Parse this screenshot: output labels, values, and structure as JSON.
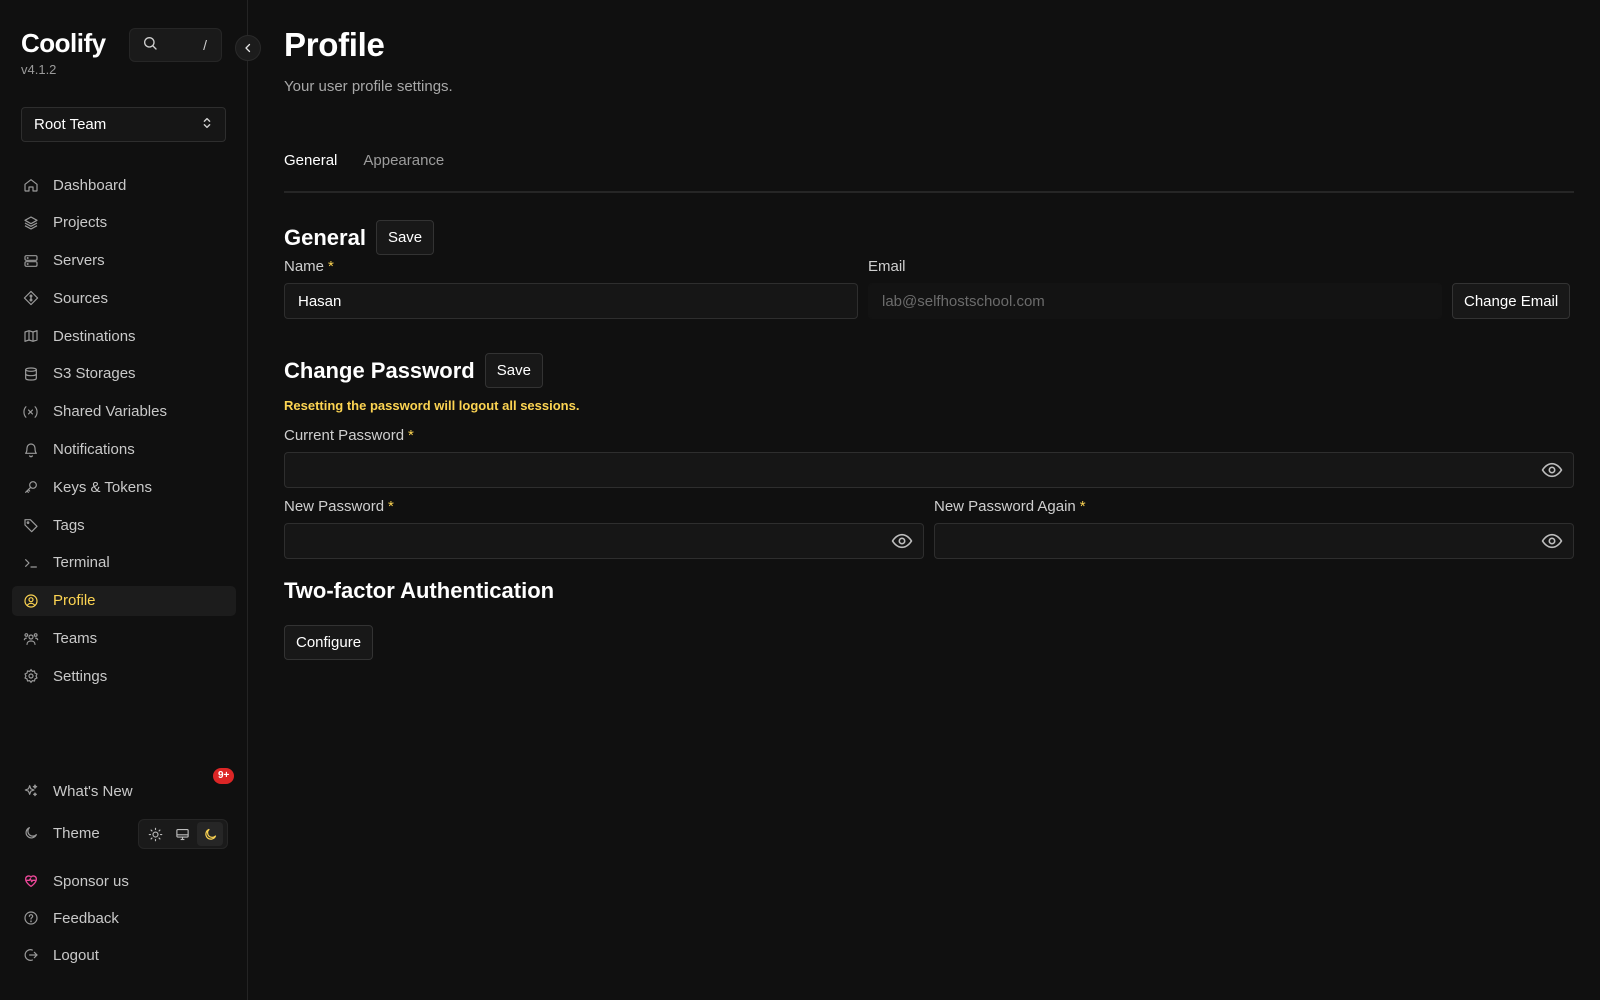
{
  "brand": {
    "title": "Coolify",
    "version": "v4.1.2"
  },
  "search": {
    "shortcut": "/"
  },
  "team": {
    "selected": "Root Team"
  },
  "nav": {
    "items": [
      {
        "label": "Dashboard",
        "icon": "home-icon"
      },
      {
        "label": "Projects",
        "icon": "layers-icon"
      },
      {
        "label": "Servers",
        "icon": "server-icon"
      },
      {
        "label": "Sources",
        "icon": "git-icon"
      },
      {
        "label": "Destinations",
        "icon": "map-icon"
      },
      {
        "label": "S3 Storages",
        "icon": "database-icon"
      },
      {
        "label": "Shared Variables",
        "icon": "variable-icon"
      },
      {
        "label": "Notifications",
        "icon": "bell-icon"
      },
      {
        "label": "Keys & Tokens",
        "icon": "key-icon"
      },
      {
        "label": "Tags",
        "icon": "tag-icon"
      },
      {
        "label": "Terminal",
        "icon": "terminal-icon"
      },
      {
        "label": "Profile",
        "icon": "user-circle-icon",
        "active": true
      },
      {
        "label": "Teams",
        "icon": "users-icon"
      },
      {
        "label": "Settings",
        "icon": "gear-icon"
      }
    ]
  },
  "bottom": {
    "whats_new": "What's New",
    "whats_new_badge": "9+",
    "theme": "Theme",
    "sponsor": "Sponsor us",
    "feedback": "Feedback",
    "logout": "Logout"
  },
  "colors": {
    "accent": "#fcd452",
    "danger": "#dc2626",
    "sponsor": "#ec4899",
    "background": "#101010"
  },
  "page": {
    "title": "Profile",
    "subtitle": "Your user profile settings."
  },
  "tabs": [
    {
      "label": "General",
      "active": true
    },
    {
      "label": "Appearance"
    }
  ],
  "general": {
    "title": "General",
    "save_label": "Save",
    "name_label": "Name",
    "name_value": "Hasan",
    "email_label": "Email",
    "email_value": "lab@selfhostschool.com",
    "change_email_label": "Change Email"
  },
  "password": {
    "title": "Change Password",
    "save_label": "Save",
    "warning": "Resetting the password will logout all sessions.",
    "current_label": "Current Password",
    "new_label": "New Password",
    "new_again_label": "New Password Again",
    "required_mark": "*"
  },
  "twofa": {
    "title": "Two-factor Authentication",
    "configure_label": "Configure"
  }
}
